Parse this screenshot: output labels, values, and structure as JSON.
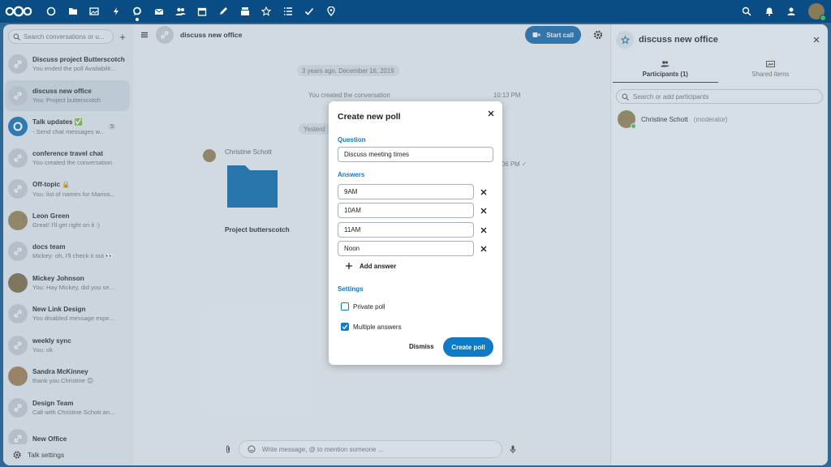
{
  "topbar": {
    "apps": [
      "dashboard-icon",
      "files-icon",
      "photos-icon",
      "activity-icon",
      "talk-icon",
      "mail-icon",
      "contacts-icon",
      "calendar-icon",
      "notes-icon",
      "deck-icon",
      "starred-icon",
      "tasks-icon",
      "checkmark-icon",
      "maps-icon"
    ],
    "active_app": "talk-icon"
  },
  "sidebar": {
    "search_placeholder": "Search conversations or u...",
    "conversations": [
      {
        "title": "Discuss project Butterscotch",
        "subtitle": "You ended the poll Availabilit..."
      },
      {
        "title": "discuss new office",
        "subtitle": "You: Project butterscotch"
      },
      {
        "title": "Talk updates ✅",
        "subtitle": "- Send chat messages w...",
        "badge": "5"
      },
      {
        "title": "conference travel chat",
        "subtitle": "You created the conversation"
      },
      {
        "title": "Off-topic 🔒",
        "subtitle": "You: list of names for Marius..."
      },
      {
        "title": "Leon Green",
        "subtitle": "Great! I'll get right on it :)"
      },
      {
        "title": "docs team",
        "subtitle": "Mickey: oh, I'll check it out 👀"
      },
      {
        "title": "Mickey Johnson",
        "subtitle": "You: Hay Mickey, did you se..."
      },
      {
        "title": "New Link Design",
        "subtitle": "You disabled message expir..."
      },
      {
        "title": "weekly sync",
        "subtitle": "You: ok"
      },
      {
        "title": "Sandra McKinney",
        "subtitle": "thank you Christine 😊"
      },
      {
        "title": "Design Team",
        "subtitle": "Call with Christine Schott an..."
      },
      {
        "title": "New Office",
        "subtitle": ""
      }
    ],
    "settings_label": "Talk settings"
  },
  "chat": {
    "title": "discuss new office",
    "start_call": "Start call",
    "date_separator": "3 years ago, December 16, 2019",
    "system_message": "You created the conversation",
    "system_time": "10:13 PM",
    "yesterday": "Yesterd",
    "author": "Christine Schott",
    "file_name": "Project butterscotch",
    "msg_time": "06 PM",
    "composer_placeholder": "Write message, @ to mention someone ..."
  },
  "panel": {
    "title": "discuss new office",
    "tab_participants": "Participants (1)",
    "tab_shared": "Shared items",
    "search_placeholder": "Search or add participants",
    "participant_name": "Christine Schott",
    "participant_role": "(moderator)"
  },
  "modal": {
    "title": "Create new poll",
    "question_label": "Question",
    "question_value": "Discuss meeting times",
    "answers_label": "Answers",
    "answers": [
      "9AM",
      "10AM",
      "11AM",
      "Noon"
    ],
    "add_answer": "Add answer",
    "settings_label": "Settings",
    "private_poll": "Private poll",
    "private_checked": false,
    "multiple_answers": "Multiple answers",
    "multiple_checked": true,
    "dismiss": "Dismiss",
    "create": "Create poll"
  },
  "colors": {
    "topbar": "#0a4d85",
    "primary": "#0f7ac6",
    "online": "#46ba61"
  }
}
